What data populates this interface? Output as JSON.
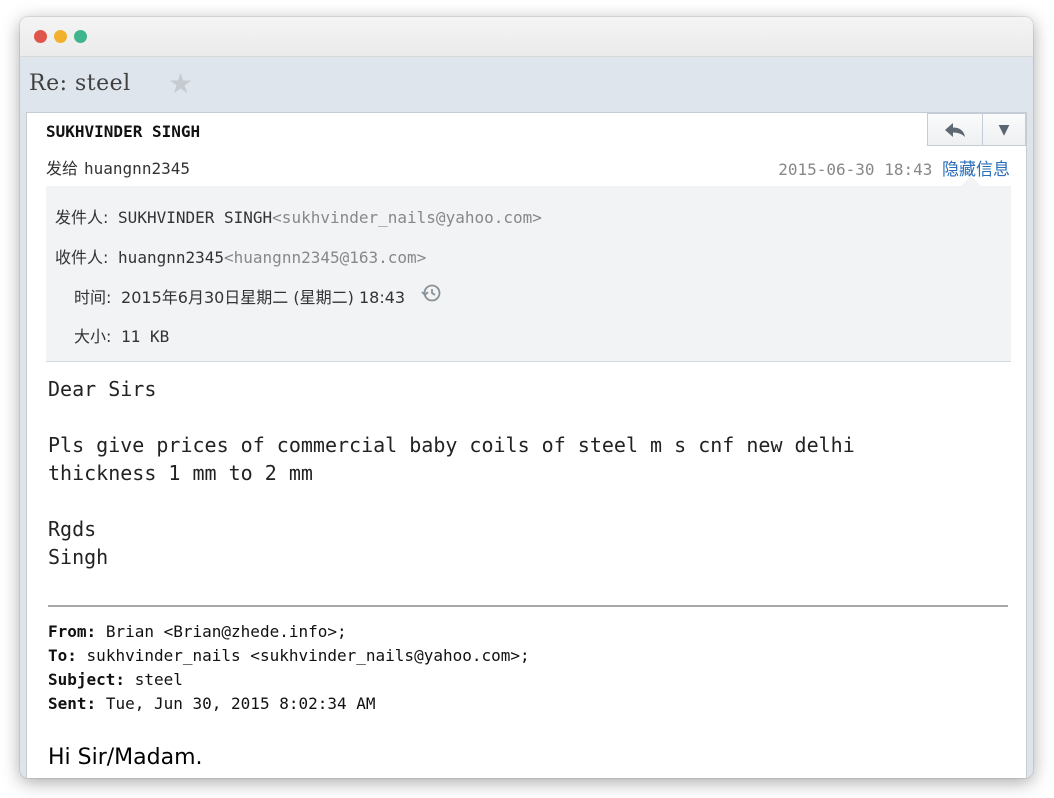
{
  "window": {
    "controls": [
      "close",
      "minimize",
      "maximize"
    ]
  },
  "subject": {
    "title": "Re: steel",
    "star_icon": "star-icon"
  },
  "header": {
    "sender_name": "SUKHVINDER SINGH",
    "to_label": "发给",
    "to_value": "huangnn2345",
    "date": "2015-06-30 18:43",
    "hide_link": "隐藏信息",
    "reply_icon": "reply-icon",
    "more_icon": "chevron-down-icon"
  },
  "details": {
    "from_label": "发件人:",
    "from_name": "SUKHVINDER SINGH",
    "from_email": "<sukhvinder_nails@yahoo.com>",
    "to_label": "收件人:",
    "to_name": "huangnn2345",
    "to_email": "<huangnn2345@163.com>",
    "time_label": "时间:",
    "time_value": "2015年6月30日星期二 (星期二) 18:43",
    "size_label": "大小:",
    "size_value": "11 KB"
  },
  "body": {
    "line1": "Dear Sirs",
    "line2": "Pls give prices of commercial baby coils of steel m s cnf new delhi",
    "line3": "thickness 1 mm to 2 mm",
    "line4": "Rgds",
    "line5": "Singh"
  },
  "quoted": {
    "from_label": "From:",
    "from_value": "Brian <Brian@zhede.info>;",
    "to_label": "To:",
    "to_value": "sukhvinder_nails <sukhvinder_nails@yahoo.com>;",
    "subject_label": "Subject:",
    "subject_value": "steel",
    "sent_label": "Sent:",
    "sent_value": "Tue, Jun 30, 2015 8:02:34 AM",
    "greeting": "Hi Sir/Madam."
  }
}
